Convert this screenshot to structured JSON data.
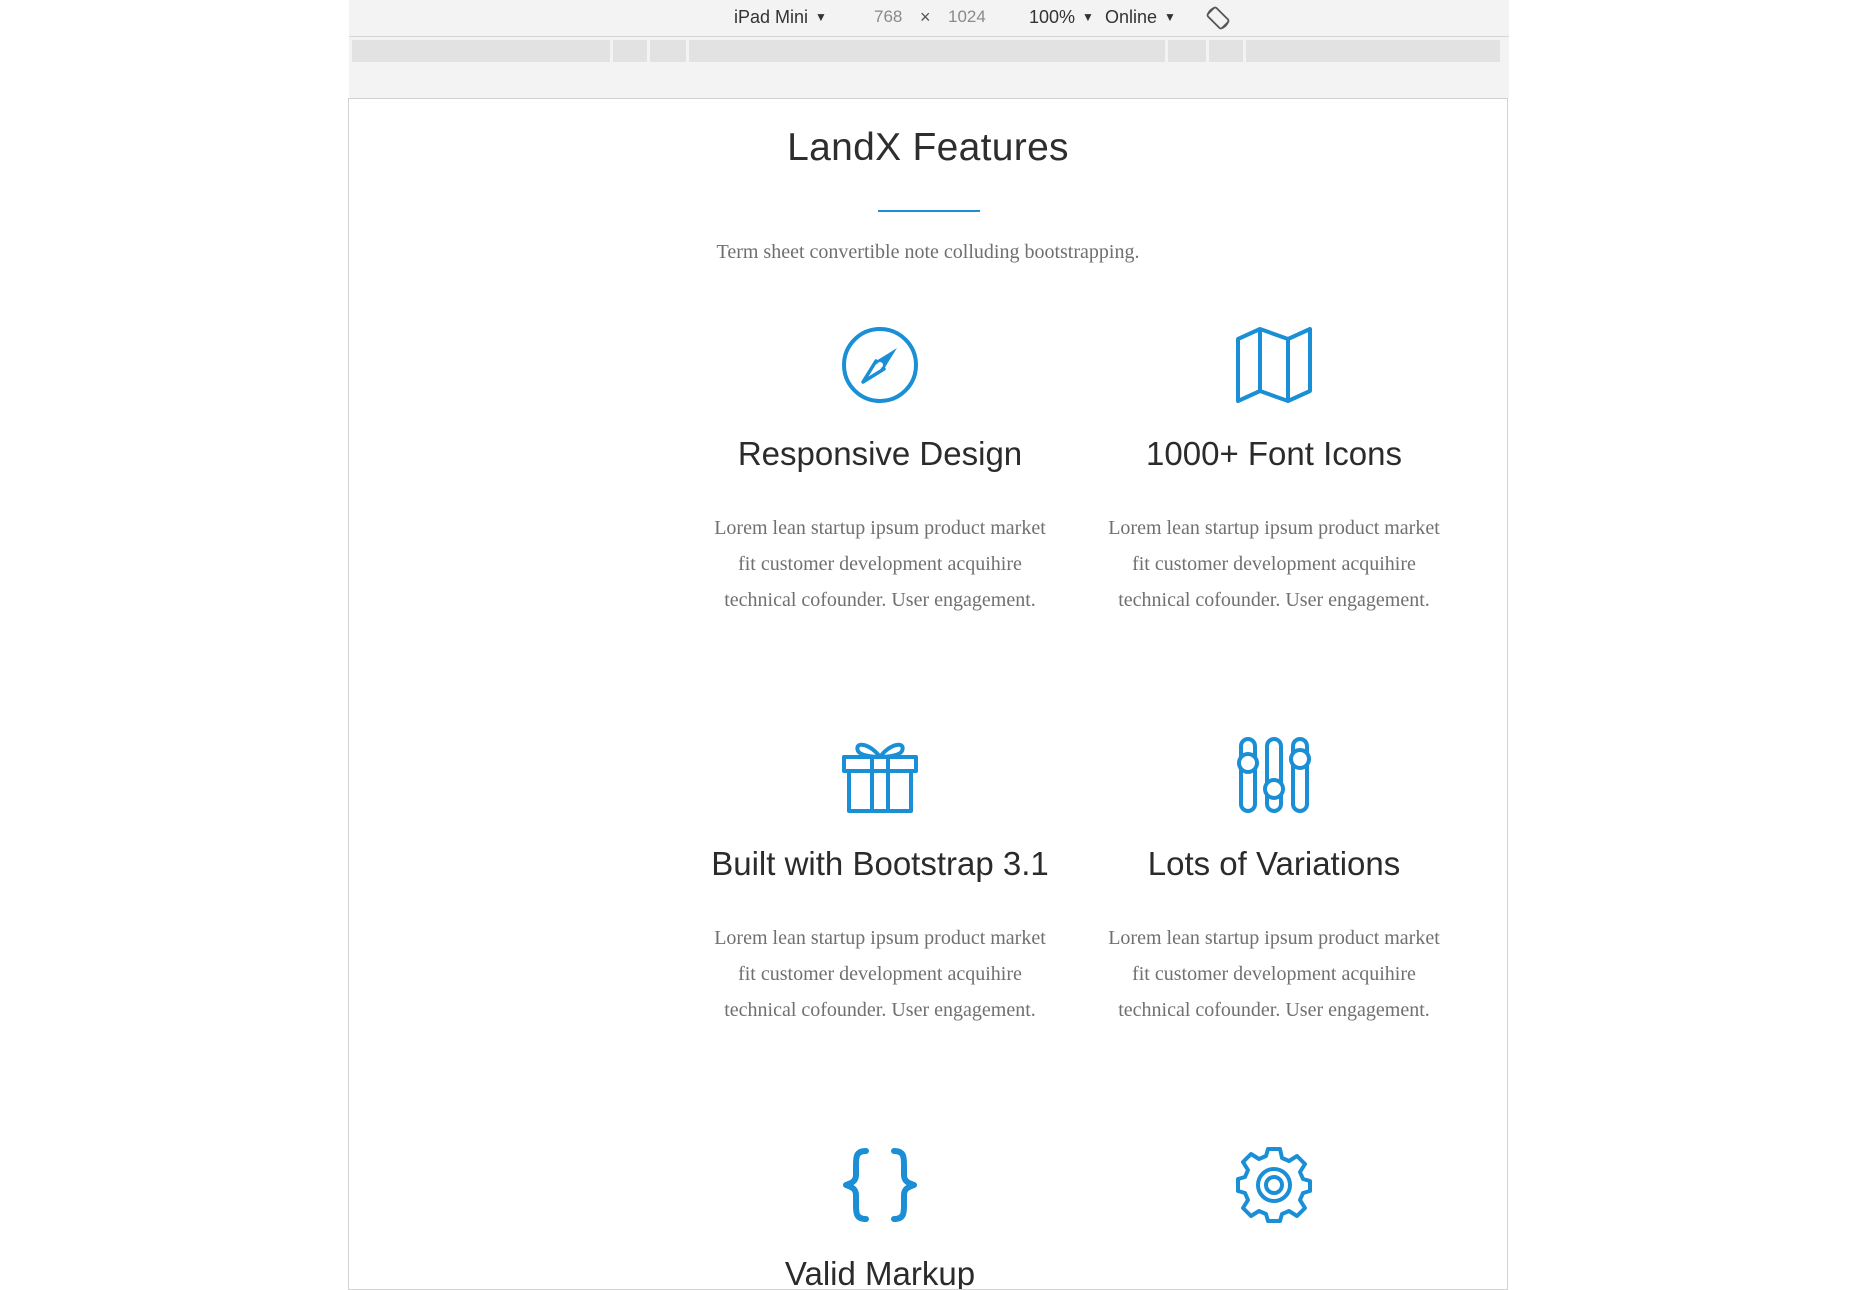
{
  "toolbar": {
    "device": "iPad Mini",
    "width": "768",
    "times": "×",
    "height": "1024",
    "zoom": "100%",
    "network": "Online"
  },
  "colors": {
    "accent": "#1a8fd6",
    "heading": "#2b2b2b",
    "body_text": "#707070"
  },
  "section": {
    "title": "LandX Features",
    "subtitle": "Term sheet convertible note colluding bootstrapping."
  },
  "features": [
    {
      "icon": "compass-icon",
      "title": "Responsive Design",
      "text": "Lorem lean startup ipsum product market fit customer development acquihire technical cofounder. User engagement."
    },
    {
      "icon": "map-icon",
      "title": "1000+ Font Icons",
      "text": "Lorem lean startup ipsum product market fit customer development acquihire technical cofounder. User engagement."
    },
    {
      "icon": "gift-icon",
      "title": "Built with Bootstrap 3.1",
      "text": "Lorem lean startup ipsum product market fit customer development acquihire technical cofounder. User engagement."
    },
    {
      "icon": "sliders-icon",
      "title": "Lots of Variations",
      "text": "Lorem lean startup ipsum product market fit customer development acquihire technical cofounder. User engagement."
    },
    {
      "icon": "code-braces-icon",
      "title": "Valid Markup",
      "text": ""
    },
    {
      "icon": "gear-icon",
      "title": "",
      "text": ""
    }
  ]
}
